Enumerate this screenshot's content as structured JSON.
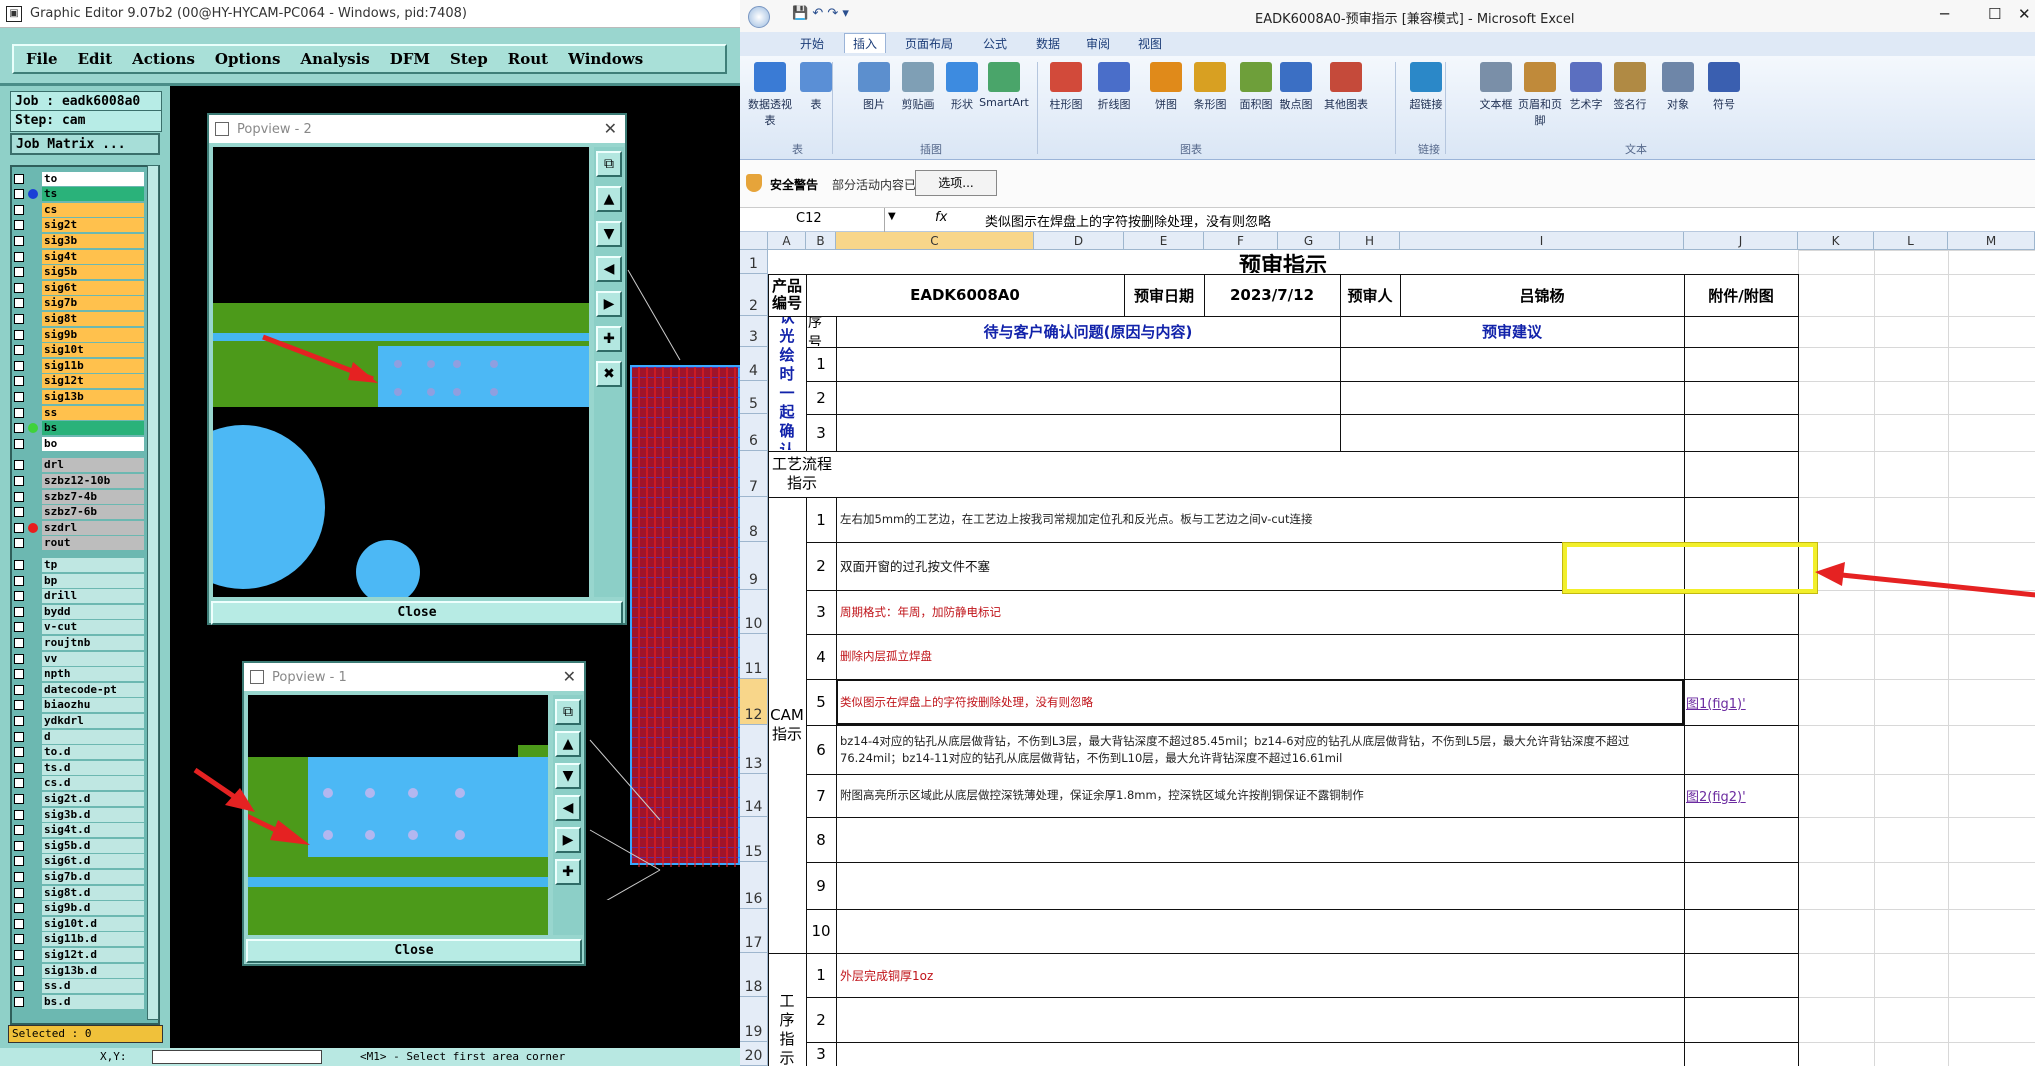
{
  "cam": {
    "title": "Graphic Editor 9.07b2 (00@HY-HYCAM-PC064 - Windows, pid:7408)",
    "menu": [
      "File",
      "Edit",
      "Actions",
      "Options",
      "Analysis",
      "DFM",
      "Step",
      "Rout",
      "Windows"
    ],
    "job_label": "Job : eadk6008a0",
    "step_label": "Step: cam",
    "matrix_label": "Job Matrix ...",
    "layers": [
      {
        "name": "to",
        "color": "#ffffff"
      },
      {
        "name": "ts",
        "color": "#2ab27a",
        "dot": "#1a3fd6"
      },
      {
        "name": "cs",
        "color": "#ffc14d"
      },
      {
        "name": "sig2t",
        "color": "#ffc14d"
      },
      {
        "name": "sig3b",
        "color": "#ffc14d"
      },
      {
        "name": "sig4t",
        "color": "#ffc14d"
      },
      {
        "name": "sig5b",
        "color": "#ffc14d"
      },
      {
        "name": "sig6t",
        "color": "#ffc14d"
      },
      {
        "name": "sig7b",
        "color": "#ffc14d"
      },
      {
        "name": "sig8t",
        "color": "#ffc14d"
      },
      {
        "name": "sig9b",
        "color": "#ffc14d"
      },
      {
        "name": "sig10t",
        "color": "#ffc14d"
      },
      {
        "name": "sig11b",
        "color": "#ffc14d"
      },
      {
        "name": "sig12t",
        "color": "#ffc14d"
      },
      {
        "name": "sig13b",
        "color": "#ffc14d"
      },
      {
        "name": "ss",
        "color": "#ffc14d"
      },
      {
        "name": "bs",
        "color": "#2ab27a",
        "dot": "#3fd23a"
      },
      {
        "name": "bo",
        "color": "#ffffff"
      },
      {
        "name": "drl",
        "color": "#bdbdbd"
      },
      {
        "name": "szbz12-10b",
        "color": "#bdbdbd"
      },
      {
        "name": "szbz7-4b",
        "color": "#bdbdbd"
      },
      {
        "name": "szbz7-6b",
        "color": "#bdbdbd"
      },
      {
        "name": "szdrl",
        "color": "#bdbdbd",
        "dot": "#e81e1e"
      },
      {
        "name": "rout",
        "color": "#bdbdbd"
      },
      {
        "name": "tp",
        "color": "#bfe7e2"
      },
      {
        "name": "bp",
        "color": "#bfe7e2"
      },
      {
        "name": "drill",
        "color": "#bfe7e2"
      },
      {
        "name": "bydd",
        "color": "#bfe7e2"
      },
      {
        "name": "v-cut",
        "color": "#bfe7e2"
      },
      {
        "name": "roujtnb",
        "color": "#bfe7e2"
      },
      {
        "name": "vv",
        "color": "#bfe7e2"
      },
      {
        "name": "npth",
        "color": "#bfe7e2"
      },
      {
        "name": "datecode-pt",
        "color": "#bfe7e2"
      },
      {
        "name": "biaozhu",
        "color": "#bfe7e2"
      },
      {
        "name": "ydkdrl",
        "color": "#bfe7e2"
      },
      {
        "name": "d",
        "color": "#bfe7e2"
      },
      {
        "name": "to.d",
        "color": "#bfe7e2"
      },
      {
        "name": "ts.d",
        "color": "#bfe7e2"
      },
      {
        "name": "cs.d",
        "color": "#bfe7e2"
      },
      {
        "name": "sig2t.d",
        "color": "#bfe7e2"
      },
      {
        "name": "sig3b.d",
        "color": "#bfe7e2"
      },
      {
        "name": "sig4t.d",
        "color": "#bfe7e2"
      },
      {
        "name": "sig5b.d",
        "color": "#bfe7e2"
      },
      {
        "name": "sig6t.d",
        "color": "#bfe7e2"
      },
      {
        "name": "sig7b.d",
        "color": "#bfe7e2"
      },
      {
        "name": "sig8t.d",
        "color": "#bfe7e2"
      },
      {
        "name": "sig9b.d",
        "color": "#bfe7e2"
      },
      {
        "name": "sig10t.d",
        "color": "#bfe7e2"
      },
      {
        "name": "sig11b.d",
        "color": "#bfe7e2"
      },
      {
        "name": "sig12t.d",
        "color": "#bfe7e2"
      },
      {
        "name": "sig13b.d",
        "color": "#bfe7e2"
      },
      {
        "name": "ss.d",
        "color": "#bfe7e2"
      },
      {
        "name": "bs.d",
        "color": "#bfe7e2"
      }
    ],
    "selected": "Selected : 0",
    "xy_label": "X,Y:",
    "prompt": "<M1> - Select first area corner",
    "popview2_title": "Popview - 2",
    "popview1_title": "Popview - 1",
    "close_label": "Close"
  },
  "excel": {
    "title": "EADK6008A0-预审指示  [兼容模式] - Microsoft Excel",
    "tabs": [
      "开始",
      "插入",
      "页面布局",
      "公式",
      "数据",
      "审阅",
      "视图"
    ],
    "ribbon": {
      "buttons": [
        "数据透视表",
        "表",
        "图片",
        "剪贴画",
        "形状",
        "SmartArt",
        "柱形图",
        "折线图",
        "饼图",
        "条形图",
        "面积图",
        "散点图",
        "其他图表",
        "超链接",
        "文本框",
        "页眉和页脚",
        "艺术字",
        "签名行",
        "对象",
        "符号"
      ],
      "groups": [
        "表",
        "插图",
        "图表",
        "链接",
        "文本"
      ]
    },
    "security": {
      "label": "安全警告",
      "message": "部分活动内容已被禁用。",
      "options": "选项..."
    },
    "namebox": "C12",
    "formula": "类似图示在焊盘上的字符按删除处理，没有则忽略",
    "col_letters": [
      "A",
      "B",
      "C",
      "D",
      "E",
      "F",
      "G",
      "H",
      "I",
      "J",
      "K",
      "L",
      "M"
    ],
    "row_numbers": [
      "1",
      "2",
      "3",
      "4",
      "5",
      "6",
      "7",
      "8",
      "9",
      "10",
      "11",
      "12",
      "13",
      "14",
      "15",
      "16",
      "17",
      "18",
      "19",
      "20"
    ],
    "sheet": {
      "title": "预审指示",
      "product_label": "产品编号",
      "product_value": "EADK6008A0",
      "date_label": "预审日期",
      "date_value": "2023/7/12",
      "reviewer_label": "预审人",
      "reviewer_value": "吕锦杨",
      "attach_label": "附件/附图",
      "seq_label": "序号",
      "issue_header": "待与客户确认问题(原因与内容)",
      "suggest_header": "预审建议",
      "pending_label": "待确认光绘时一起确认问题",
      "process_label": "工艺流程指示",
      "cam_label": "CAM指示",
      "work_label": "工序指示",
      "pending_nums": [
        "1",
        "2",
        "3"
      ],
      "cam_nums": [
        "1",
        "2",
        "3",
        "4",
        "5",
        "6",
        "7",
        "8",
        "9",
        "10"
      ],
      "work_nums": [
        "1",
        "2",
        "3"
      ],
      "cam_items": [
        "左右加5mm的工艺边，在工艺边上按我司常规加定位孔和反光点。板与工艺边之间v-cut连接",
        "双面开窗的过孔按文件不塞",
        "周期格式：年周，加防静电标记",
        "删除内层孤立焊盘",
        "类似图示在焊盘上的字符按删除处理，没有则忽略",
        "bz14-4对应的钻孔从底层做背钻，不伤到L3层，最大背钻深度不超过85.45mil；bz14-6对应的钻孔从底层做背钻，不伤到L5层，最大允许背钻深度不超过76.24mil；bz14-11对应的钻孔从底层做背钻，不伤到L10层，最大允许背钻深度不超过16.61mil",
        "附图高亮所示区域此从底层做控深铣薄处理，保证余厚1.8mm，控深铣区域允许按削铜保证不露铜制作",
        "",
        "",
        ""
      ],
      "work_items": [
        "外层完成铜厚1oz",
        "",
        ""
      ],
      "attach_links": [
        "图1(fig1)'",
        "图2(fig2)'"
      ]
    }
  }
}
